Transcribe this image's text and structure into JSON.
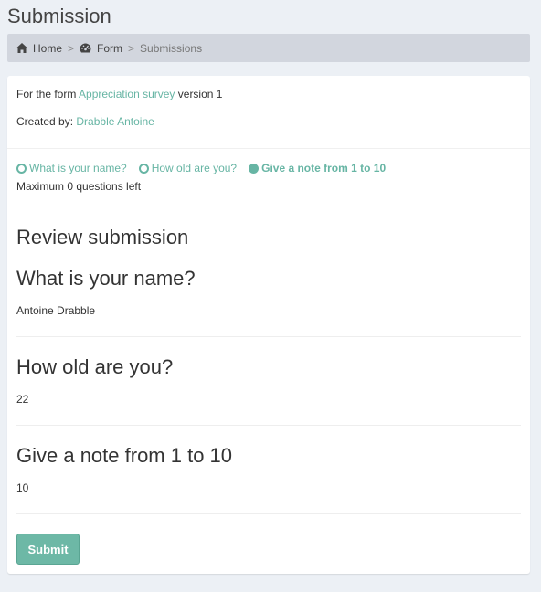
{
  "page": {
    "title": "Submission"
  },
  "breadcrumb": {
    "home": "Home",
    "form": "Form",
    "current": "Submissions",
    "separator": ">"
  },
  "info": {
    "form_prefix": "For the form",
    "form_name": "Appreciation survey",
    "form_version": "version 1",
    "created_by_label": "Created by:",
    "created_by_name": "Drabble Antoine"
  },
  "steps": [
    {
      "label": "What is your name?",
      "active": false
    },
    {
      "label": "How old are you?",
      "active": false
    },
    {
      "label": "Give a note from 1 to 10",
      "active": true
    }
  ],
  "remaining": "Maximum 0 questions left",
  "review": {
    "title": "Review submission",
    "questions": [
      {
        "question": "What is your name?",
        "answer": "Antoine Drabble"
      },
      {
        "question": "How old are you?",
        "answer": "22"
      },
      {
        "question": "Give a note from 1 to 10",
        "answer": "10"
      }
    ]
  },
  "actions": {
    "submit": "Submit"
  },
  "colors": {
    "accent": "#67b5a4",
    "background": "#ecf0f5",
    "breadcrumb_bg": "#d2d6de"
  },
  "icons": {
    "home": "home-icon",
    "form": "dashboard-icon"
  }
}
